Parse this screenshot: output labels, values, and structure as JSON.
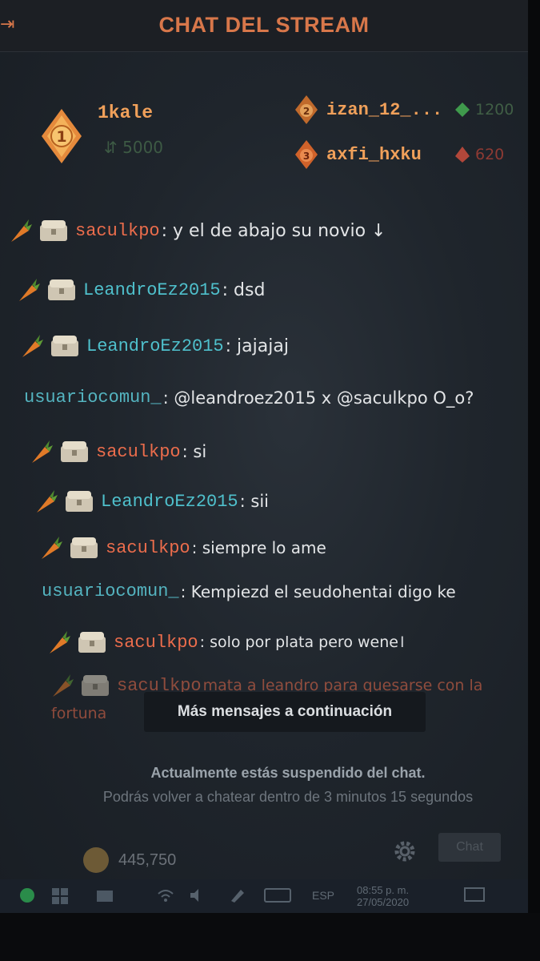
{
  "header": {
    "title": "CHAT DEL STREAM",
    "back_icon": "arrow-left-icon"
  },
  "podium": {
    "first": {
      "rank": "1",
      "name": "1kale",
      "score": "5000"
    },
    "second": {
      "rank": "2",
      "name": "izan_12_...",
      "score": "1200"
    },
    "third": {
      "rank": "3",
      "name": "axfi_hxku",
      "score": "620"
    }
  },
  "messages": [
    {
      "user": "saculkpo",
      "text": ": y el de abajo su novio ↓"
    },
    {
      "user": "LeandroEz2015",
      "text": ": dsd"
    },
    {
      "user": "LeandroEz2015",
      "text": ": jajajaj"
    },
    {
      "user": "usuariocomun_",
      "text": ": @leandroez2015 x @saculkpo O_o?"
    },
    {
      "user": "saculkpo",
      "text": ": si"
    },
    {
      "user": "LeandroEz2015",
      "text": ": sii"
    },
    {
      "user": "saculkpo",
      "text": ": siempre lo ame"
    },
    {
      "user": "usuariocomun_",
      "text": ": Kempiezd el seudohentai digo ke"
    },
    {
      "user": "saculkpo",
      "text": ": solo por plata pero wene"
    },
    {
      "user": "saculkpo",
      "text": " mata a leandro para quesarse con la",
      "text2": "fortuna"
    }
  ],
  "more_messages_label": "Más mensajes a continuación",
  "suspension": {
    "title": "Actualmente estás suspendido del chat.",
    "detail": "Podrás volver a chatear dentro de 3 minutos 15 segundos"
  },
  "footer": {
    "coins": "445,750",
    "chat_button": "Chat"
  },
  "taskbar": {
    "language": "ESP",
    "time": "08:55 p. m.",
    "date": "27/05/2020"
  },
  "colors": {
    "accent_orange": "#d8774a",
    "user_orange": "#ec6d4c",
    "user_cyan": "#4fc0cc"
  }
}
